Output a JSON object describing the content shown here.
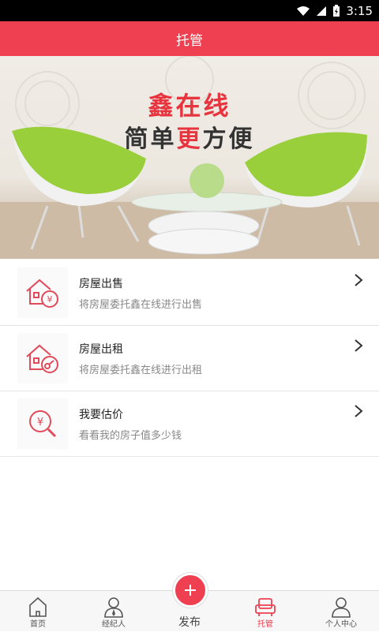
{
  "status": {
    "time": "3:15"
  },
  "header": {
    "title": "托管"
  },
  "banner": {
    "line1": "鑫在线",
    "line2_pre": "简单",
    "line2_hl": "更",
    "line2_post": "方便"
  },
  "items": [
    {
      "title": "房屋出售",
      "subtitle": "将房屋委托鑫在线进行出售",
      "icon": "house-sale-icon"
    },
    {
      "title": "房屋出租",
      "subtitle": "将房屋委托鑫在线进行出租",
      "icon": "house-rent-icon"
    },
    {
      "title": "我要估价",
      "subtitle": "看看我的房子值多少钱",
      "icon": "valuation-icon"
    }
  ],
  "tabs": [
    {
      "label": "首页"
    },
    {
      "label": "经纪人"
    },
    {
      "label": "发布"
    },
    {
      "label": "托管"
    },
    {
      "label": "个人中心"
    }
  ],
  "colors": {
    "accent": "#ee4050"
  }
}
